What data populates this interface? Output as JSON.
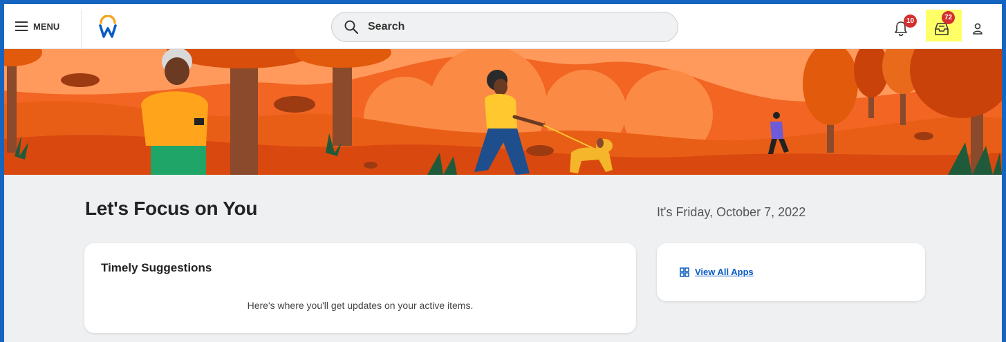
{
  "header": {
    "menu_label": "MENU",
    "search_placeholder": "Search",
    "notifications_count": "10",
    "inbox_count": "72"
  },
  "main": {
    "title": "Let's Focus on You",
    "date": "It's Friday, October 7, 2022",
    "suggestions_card": {
      "title": "Timely Suggestions",
      "body": "Here's where you'll get updates on your active items."
    },
    "apps_card": {
      "link_label": "View All Apps"
    }
  },
  "colors": {
    "frame_border": "#1565c0",
    "badge": "#d32f2f",
    "inbox_highlight": "#ffff66",
    "link": "#0a5bc4",
    "banner_orange": "#f26522"
  },
  "icons": [
    "hamburger-icon",
    "workday-logo",
    "search-icon",
    "bell-icon",
    "inbox-icon",
    "user-icon",
    "apps-grid-icon"
  ]
}
